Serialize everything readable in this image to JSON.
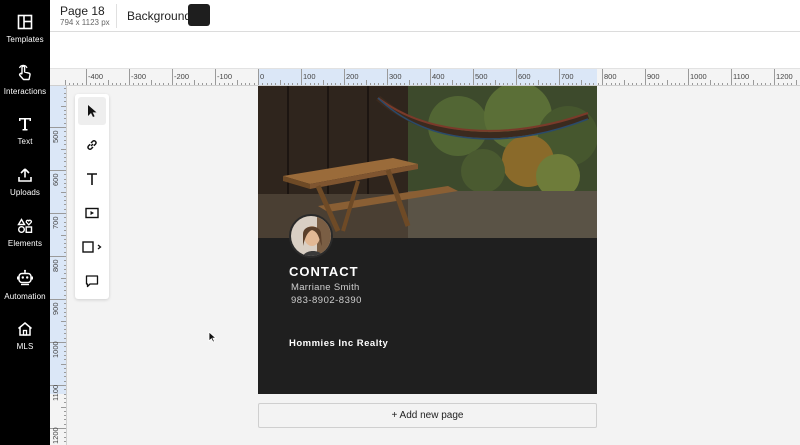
{
  "sidebar": {
    "items": [
      {
        "label": "Templates"
      },
      {
        "label": "Interactions"
      },
      {
        "label": "Text"
      },
      {
        "label": "Uploads"
      },
      {
        "label": "Elements"
      },
      {
        "label": "Automation"
      },
      {
        "label": "MLS"
      }
    ]
  },
  "topbar": {
    "page_title": "Page 18",
    "page_size": "794 x 1123 px",
    "background_label": "Background",
    "background_color": "#1e1e1e"
  },
  "rulers": {
    "horizontal_labels": [
      "-400",
      "-300",
      "-200",
      "-100",
      "0",
      "100",
      "200",
      "300",
      "400",
      "500",
      "600",
      "700",
      "800",
      "900",
      "1000",
      "1100",
      "1200"
    ],
    "vertical_labels": [
      "500",
      "600",
      "700",
      "800",
      "900",
      "1000",
      "1100",
      "1200"
    ]
  },
  "tools": [
    "select",
    "link",
    "text",
    "video",
    "shape",
    "comment"
  ],
  "canvas": {
    "heading": "CONTACT",
    "name": "Marriane Smith",
    "phone": "983-8902-8390",
    "company": "Hommies Inc Realty"
  },
  "add_page_label": "+ Add new page"
}
